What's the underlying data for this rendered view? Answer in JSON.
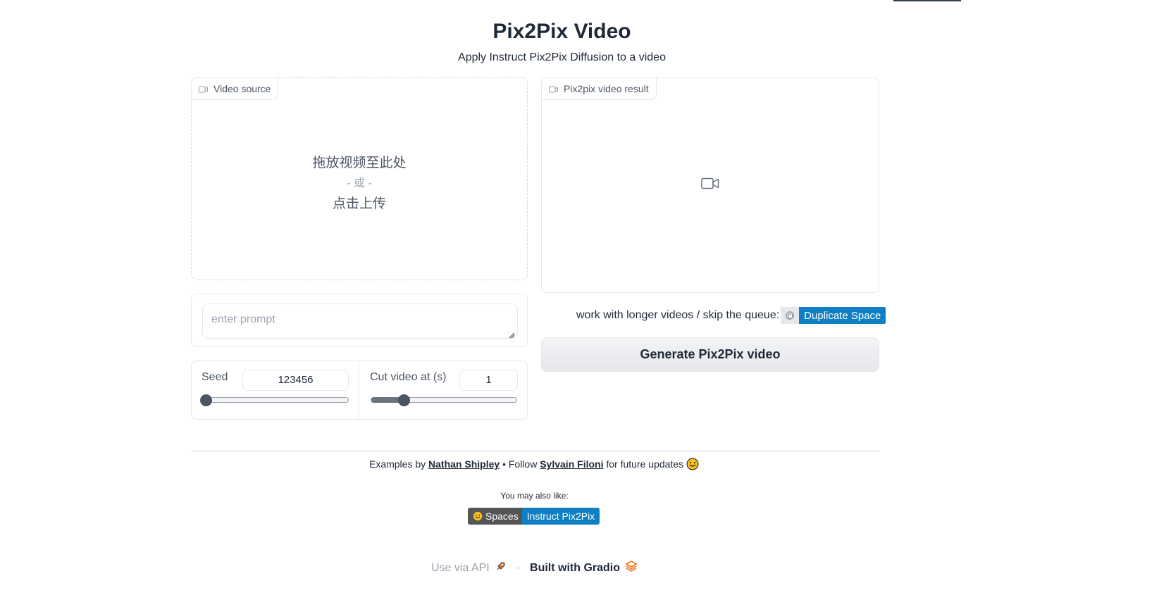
{
  "header": {
    "title": "Pix2Pix Video",
    "subtitle": "Apply Instruct Pix2Pix Diffusion to a video"
  },
  "video_source": {
    "label": "Video source",
    "drop_line1": "拖放视频至此处",
    "drop_or": "- 或 -",
    "drop_line2": "点击上传"
  },
  "video_result": {
    "label": "Pix2pix video result"
  },
  "prompt": {
    "placeholder": "enter prompt"
  },
  "seed": {
    "label": "Seed",
    "value": "123456",
    "slider_fraction": 0.0
  },
  "cut": {
    "label": "Cut video at (s)",
    "value": "1",
    "slider_fraction": 0.22
  },
  "queue": {
    "text": "work with longer videos / skip the queue:",
    "duplicate_label": "Duplicate Space"
  },
  "generate_button": "Generate Pix2Pix video",
  "footer": {
    "examples_by": "Examples by",
    "nathan": "Nathan Shipley",
    "follow": "Follow",
    "sylvain": "Sylvain Filoni",
    "updates": "for future updates",
    "also_like": "You may also like:",
    "spaces_label": "Spaces",
    "instruct_label": "Instruct Pix2Pix"
  },
  "bottom": {
    "api": "Use via API",
    "separator": "·",
    "built": "Built with Gradio"
  },
  "colors": {
    "accent": "#0e7fc2",
    "badge_dark": "#555555",
    "gradio_orange": "#f97316"
  }
}
